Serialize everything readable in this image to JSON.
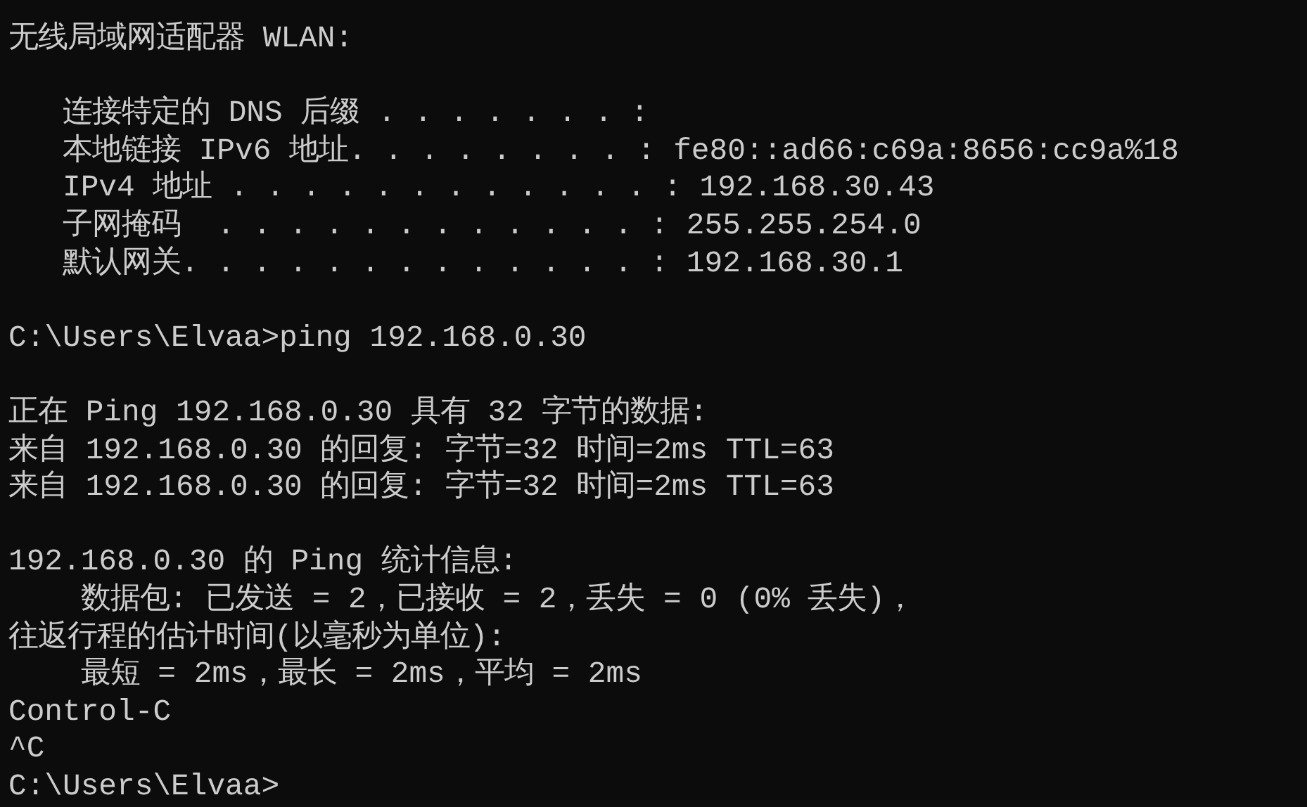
{
  "console": {
    "blocks": [
      {
        "lines": [
          "无线局域网适配器 WLAN:"
        ]
      },
      {
        "lines": [
          "   连接特定的 DNS 后缀 . . . . . . . :",
          "   本地链接 IPv6 地址. . . . . . . . : fe80::ad66:c69a:8656:cc9a%18",
          "   IPv4 地址 . . . . . . . . . . . . : 192.168.30.43",
          "   子网掩码  . . . . . . . . . . . . : 255.255.254.0",
          "   默认网关. . . . . . . . . . . . . : 192.168.30.1"
        ]
      },
      {
        "lines": [
          "C:\\Users\\Elvaa>ping 192.168.0.30"
        ]
      },
      {
        "lines": [
          "正在 Ping 192.168.0.30 具有 32 字节的数据:",
          "来自 192.168.0.30 的回复: 字节=32 时间=2ms TTL=63",
          "来自 192.168.0.30 的回复: 字节=32 时间=2ms TTL=63"
        ]
      },
      {
        "lines": [
          "192.168.0.30 的 Ping 统计信息:",
          "    数据包: 已发送 = 2，已接收 = 2，丢失 = 0 (0% 丢失)，",
          "往返行程的估计时间(以毫秒为单位):",
          "    最短 = 2ms，最长 = 2ms，平均 = 2ms",
          "Control-C",
          "^C",
          "C:\\Users\\Elvaa>"
        ]
      }
    ]
  }
}
